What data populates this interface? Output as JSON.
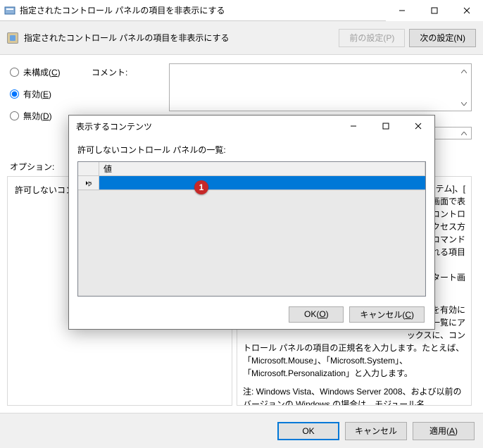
{
  "window": {
    "title": "指定されたコントロール パネルの項目を非表示にする",
    "minimize": "–",
    "maximize": "□",
    "close": "✕"
  },
  "header": {
    "title": "指定されたコントロール パネルの項目を非表示にする",
    "prev_btn": "前の設定(P)",
    "next_btn": "次の設定(N)"
  },
  "radios": {
    "not_configured": "未構成(C)",
    "enabled": "有効(E)",
    "disabled": "無効(D)",
    "selected": "enabled"
  },
  "labels": {
    "comment": "コメント:",
    "options": "オプション:"
  },
  "options": {
    "line1": "許可しないコントロ"
  },
  "help": {
    "frag1": "[システム]、[",
    "frag2": "ート画面で表",
    "frag3": "画面とコントロ",
    "frag4": "のアクセス方",
    "frag5": "用するコマンド",
    "frag6": "ックスに、コン",
    "frag7": "ックスされる項目",
    "frag8": "タとスタート画",
    "frag9": "設定を有効に",
    "frag10": "目の一覧にア",
    "para1": "トロール パネルの項目の正規名を入力します。たとえば、「Microsoft.Mouse」、「Microsoft.System」、「Microsoft.Personalization」と入力します。",
    "para2": "注: Windows Vista、Windows Server 2008、および以前のバージョンの Windows の場合は、モジュール名 (「timedate.cpl」、"
  },
  "footer": {
    "ok": "OK",
    "cancel": "キャンセル",
    "apply": "適用(A)"
  },
  "dialog": {
    "title": "表示するコンテンツ",
    "label": "許可しないコントロール パネルの一覧:",
    "col_header": "値",
    "ok": "OK(O)",
    "cancel": "キャンセル(C)"
  },
  "annotation": {
    "n1": "1"
  }
}
